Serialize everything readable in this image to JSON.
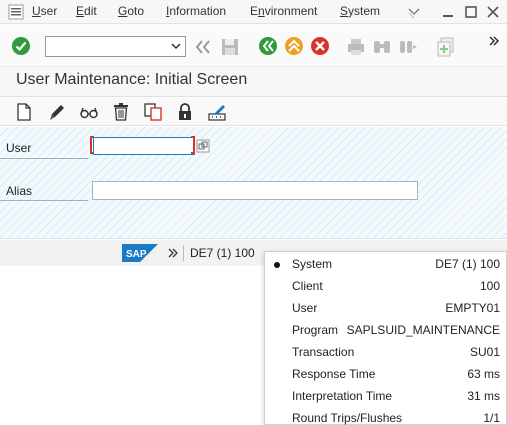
{
  "menubar": {
    "items": [
      {
        "label": "User",
        "accel": "U",
        "rest": "ser"
      },
      {
        "label": "Edit",
        "accel": "E",
        "rest": "dit"
      },
      {
        "label": "Goto",
        "accel": "G",
        "rest": "oto"
      },
      {
        "label": "Information",
        "accel": "I",
        "rest": "nformation"
      },
      {
        "label": "Environment",
        "accel": "n",
        "pre": "E",
        "rest": "vironment"
      },
      {
        "label": "System",
        "accel": "S",
        "rest": "ystem"
      }
    ]
  },
  "toolbar": {
    "command_value": "",
    "icons": [
      "enter-check-icon",
      "command-dropdown",
      "double-chevron-left-icon",
      "save-icon",
      "back-icon",
      "exit-icon",
      "cancel-icon",
      "print-icon",
      "find-icon",
      "find-next-icon",
      "create-session-icon",
      "shortcut-icon",
      "more-icon"
    ]
  },
  "title": "User Maintenance: Initial Screen",
  "app_toolbar": {
    "icons": [
      "create-icon",
      "change-icon",
      "display-icon",
      "delete-icon",
      "copy-icon",
      "lock-unlock-icon",
      "change-password-icon"
    ]
  },
  "form": {
    "user_label": "User",
    "user_value": "",
    "alias_label": "Alias",
    "alias_value": ""
  },
  "status": {
    "logo": "SAP",
    "system": "DE7 (1) 100"
  },
  "system_popup": {
    "rows": [
      {
        "label": "System",
        "value": "DE7 (1) 100",
        "selected": true
      },
      {
        "label": "Client",
        "value": "100"
      },
      {
        "label": "User",
        "value": "EMPTY01"
      },
      {
        "label": "Program",
        "value": "SAPLSUID_MAINTENANCE"
      },
      {
        "label": "Transaction",
        "value": "SU01"
      },
      {
        "label": "Response Time",
        "value": "63 ms"
      },
      {
        "label": "Interpretation Time",
        "value": "31 ms"
      },
      {
        "label": "Round Trips/Flushes",
        "value": "1/1"
      }
    ]
  },
  "colors": {
    "accent_green": "#2e9b3e",
    "accent_orange": "#f0a020",
    "accent_red": "#d9342b",
    "sap_blue": "#1a7bc4"
  }
}
